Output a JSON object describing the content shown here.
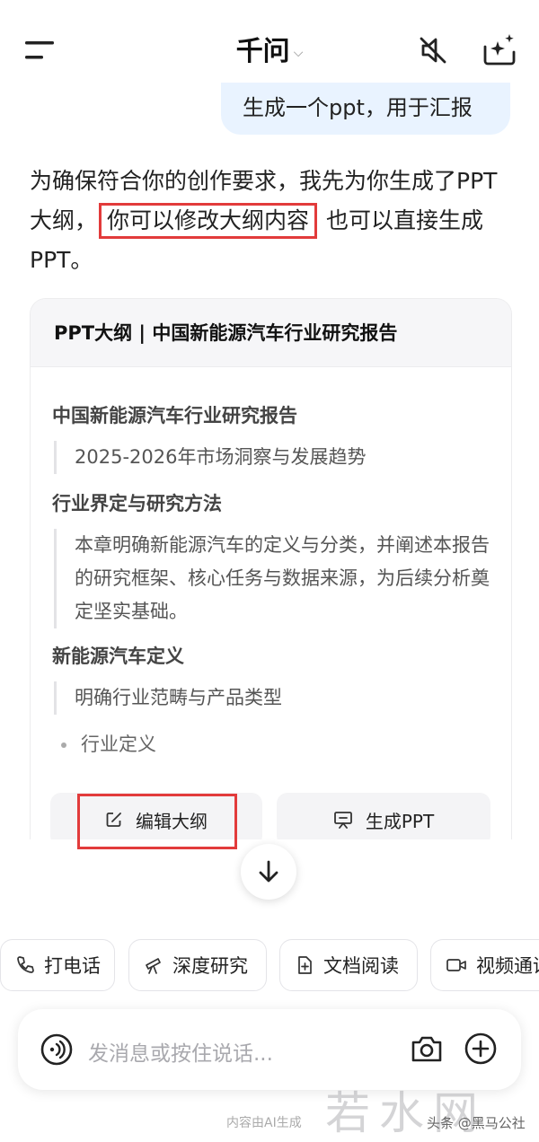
{
  "header": {
    "title": "千问",
    "icons": [
      "menu-icon",
      "chevron-down-icon",
      "mute-icon",
      "new-chat-sparkle-icon"
    ]
  },
  "user_message": "生成一个ppt，用于汇报",
  "assistant": {
    "text_before": "为确保符合你的创作要求，我先为你生成了PPT大纲，",
    "highlight": "你可以修改大纲内容",
    "text_after": "也可以直接生成PPT。"
  },
  "outline_card": {
    "header": "PPT大纲 | 中国新能源汽车行业研究报告",
    "sections": [
      {
        "title": "中国新能源汽车行业研究报告",
        "desc": "2025-2026年市场洞察与发展趋势"
      },
      {
        "title": "行业界定与研究方法",
        "desc": "本章明确新能源汽车的定义与分类，并阐述本报告的研究框架、核心任务与数据来源，为后续分析奠定坚实基础。"
      },
      {
        "title": "新能源汽车定义",
        "desc": "明确行业范畴与产品类型"
      }
    ],
    "bullet": "行业定义",
    "edit_button": "编辑大纲",
    "generate_button": "生成PPT"
  },
  "quick_actions": [
    "打电话",
    "深度研究",
    "文档阅读",
    "视频通话"
  ],
  "input": {
    "placeholder": "发消息或按住说话..."
  },
  "footer": {
    "disclaimer": "内容由AI生成",
    "watermark": "若水网",
    "source": "头条 @黑马公社"
  },
  "colors": {
    "accent_red": "#e23b3b",
    "bubble": "#e9f3ff"
  }
}
